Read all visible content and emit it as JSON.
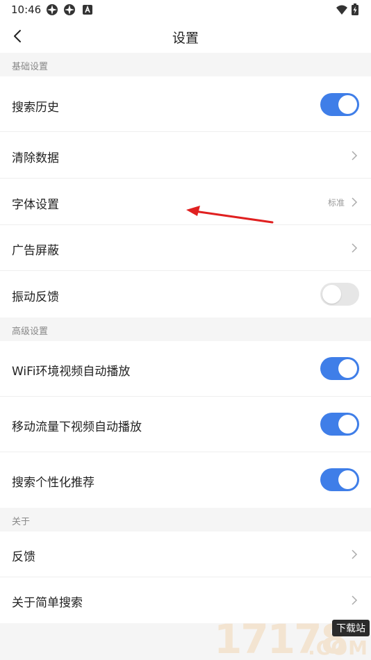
{
  "status_bar": {
    "time": "10:46",
    "icons": [
      "app-icon-1",
      "app-icon-2",
      "notification-a-icon",
      "wifi-icon",
      "battery-charging-icon"
    ]
  },
  "header": {
    "title": "设置",
    "back_icon": "chevron-left-icon"
  },
  "sections": [
    {
      "title": "基础设置",
      "items": [
        {
          "label": "搜索历史",
          "control": "toggle",
          "on": true
        },
        {
          "label": "清除数据",
          "control": "chevron"
        },
        {
          "label": "字体设置",
          "control": "chevron",
          "value": "标准"
        },
        {
          "label": "广告屏蔽",
          "control": "chevron"
        },
        {
          "label": "振动反馈",
          "control": "toggle",
          "on": false
        }
      ]
    },
    {
      "title": "高级设置",
      "items": [
        {
          "label": "WiFi环境视频自动播放",
          "control": "toggle",
          "on": true
        },
        {
          "label": "移动流量下视频自动播放",
          "control": "toggle",
          "on": true
        },
        {
          "label": "搜索个性化推荐",
          "control": "toggle",
          "on": true
        }
      ]
    },
    {
      "title": "关于",
      "items": [
        {
          "label": "反馈",
          "control": "chevron"
        },
        {
          "label": "关于简单搜索",
          "control": "chevron"
        }
      ]
    }
  ],
  "watermark": {
    "digits": "17178",
    "badge": "下载站",
    "suffix": ".COM"
  },
  "colors": {
    "toggle_on": "#3f7ee8",
    "toggle_off": "#e6e6e6",
    "annotation_arrow": "#e02020"
  }
}
